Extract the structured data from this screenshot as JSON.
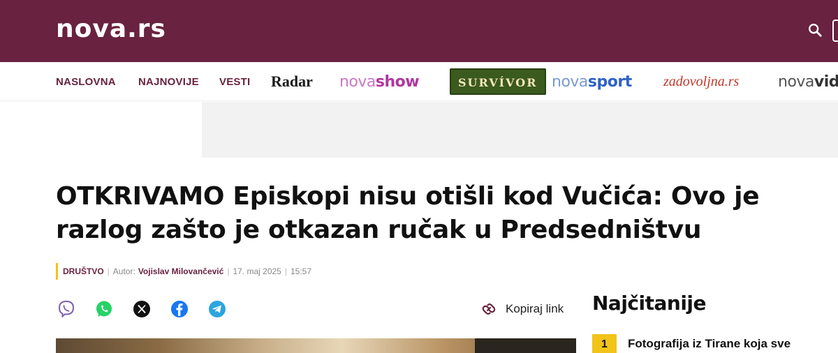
{
  "header": {
    "logo": "nova.rs",
    "bg_color": "#69223f",
    "search_icon": "search-icon",
    "menu_icon": "menu-icon"
  },
  "nav": {
    "naslovna": "NASLOVNA",
    "najnovije": "NAJNOVIJE",
    "vesti": "VESTI",
    "radar": "Radar",
    "novashow_a": "nova",
    "novashow_b": "show",
    "survivor": "SURVÍVOR",
    "novasport_a": "nova",
    "novasport_b": "sport",
    "zadovoljna": "zadovoljna.rs",
    "novavid_a": "nova",
    "novavid_b": "vid"
  },
  "article": {
    "headline": "OTKRIVAMO Episkopi nisu otišli kod Vučića: Ovo je razlog zašto je otkazan ručak u Predsedništvu",
    "category": "DRUŠTVO",
    "author_label": "Autor:",
    "author": "Vojislav Milovančević",
    "date": "17. maj 2025",
    "time": "15:57",
    "accent_color": "#f2c318"
  },
  "share": {
    "icons": [
      "viber-icon",
      "whatsapp-icon",
      "x-icon",
      "facebook-icon",
      "telegram-icon"
    ],
    "copy_link": "Kopiraj link"
  },
  "sidebar": {
    "title": "Najčitanije",
    "items": [
      {
        "rank": "1",
        "title": "Fotografija iz Tirane koja sve"
      }
    ]
  }
}
